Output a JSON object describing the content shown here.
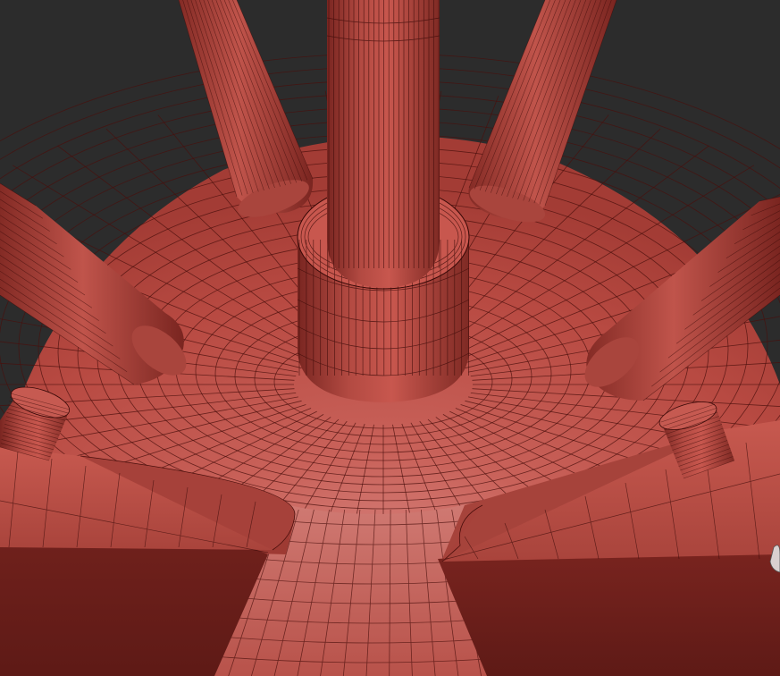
{
  "viewport": {
    "name": "3d-viewport-perspective",
    "shading": "wireframe-on-shaded",
    "background_color": "#2c2c2c"
  },
  "model": {
    "base_color": "#c2534a",
    "base_highlight": "#d4766e",
    "shadow_color": "#6e1f1a",
    "wire_color": "#3a0a08"
  },
  "labels": {
    "sr_title": ""
  }
}
